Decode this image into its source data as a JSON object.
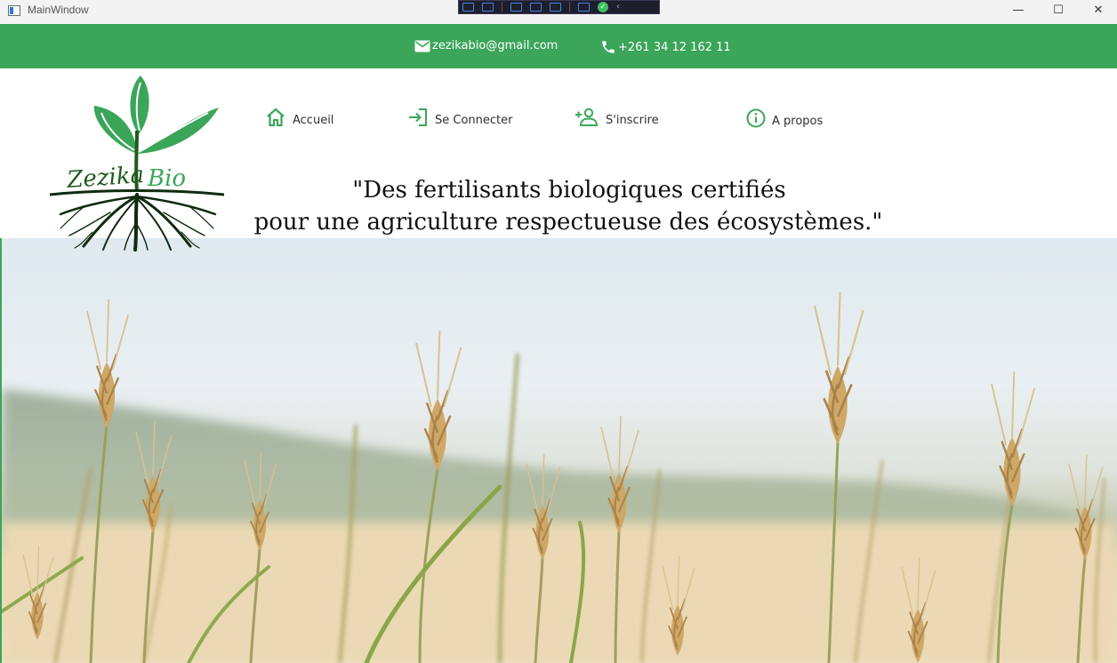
{
  "window": {
    "title": "MainWindow",
    "controls": {
      "minimize": "—",
      "maximize": "☐",
      "close": "✕"
    }
  },
  "contact": {
    "email": "zezikabio@gmail.com",
    "phone": "+261 34 12 162 11",
    "email_icon": "mail-icon",
    "phone_icon": "phone-icon"
  },
  "brand": {
    "logo_text": "Zezika Bio"
  },
  "nav": {
    "home": {
      "label": "Accueil",
      "icon": "home-icon"
    },
    "login": {
      "label": "Se Connecter",
      "icon": "login-icon"
    },
    "signup": {
      "label": "S'inscrire",
      "icon": "add-user-icon"
    },
    "about": {
      "label": "A propos",
      "icon": "info-icon"
    }
  },
  "tagline": {
    "line1": "\"Des fertilisants biologiques certifiés",
    "line2": "pour une agriculture respectueuse des écosystèmes.\""
  },
  "colors": {
    "brand_green": "#3ba559",
    "text_dark": "#111111"
  }
}
